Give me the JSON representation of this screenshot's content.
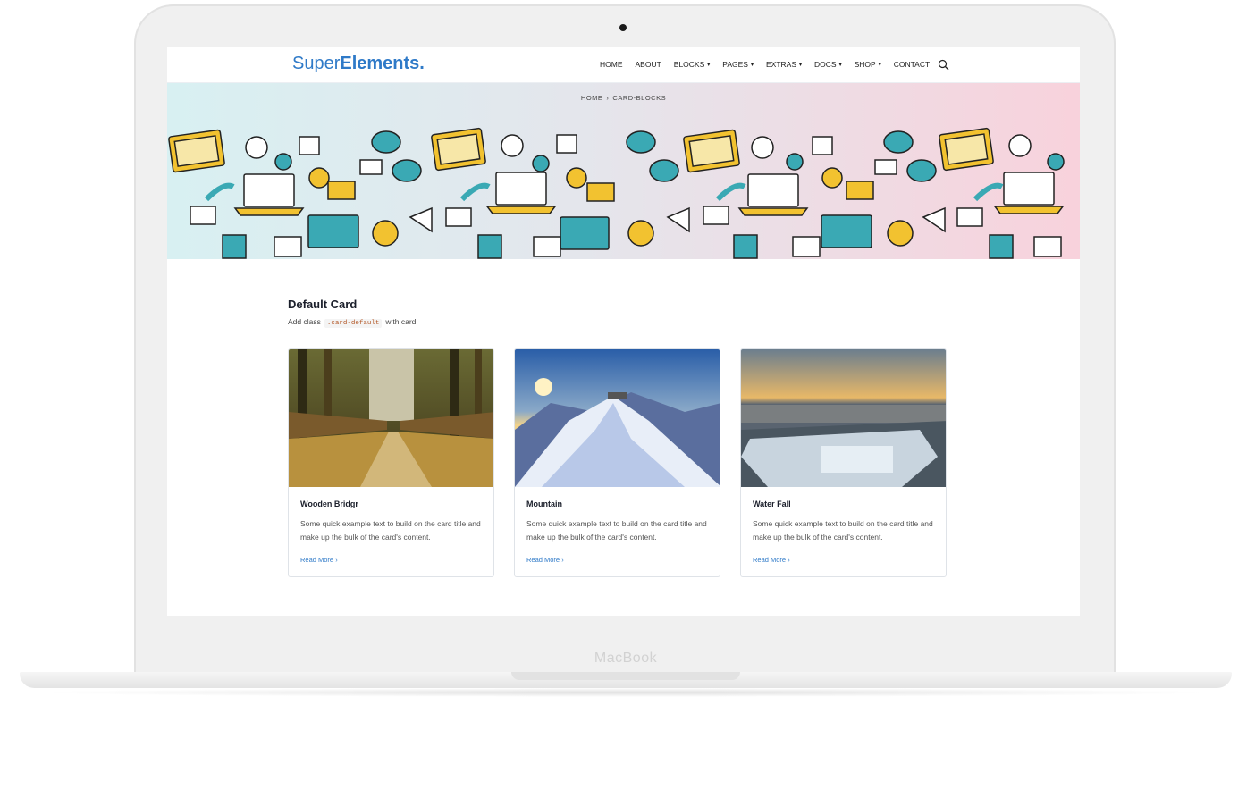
{
  "device": {
    "label": "MacBook"
  },
  "nav": {
    "logo_light": "Super",
    "logo_bold": "Elements.",
    "items": [
      {
        "label": "HOME",
        "caret": false
      },
      {
        "label": "ABOUT",
        "caret": false
      },
      {
        "label": "BLOCKS",
        "caret": true
      },
      {
        "label": "PAGES",
        "caret": true
      },
      {
        "label": "EXTRAS",
        "caret": true
      },
      {
        "label": "DOCS",
        "caret": true
      },
      {
        "label": "SHOP",
        "caret": true
      },
      {
        "label": "CONTACT",
        "caret": false
      }
    ],
    "caret_glyph": "▾",
    "search_icon": "search-icon"
  },
  "breadcrumb": {
    "home": "HOME",
    "separator": "›",
    "current": "CARD-BLOCKS"
  },
  "section": {
    "title": "Default Card",
    "sub_prefix": "Add class",
    "sub_code": ".card-default",
    "sub_suffix": "with card"
  },
  "cards": [
    {
      "title": "Wooden Bridgr",
      "text": "Some quick example text to build on the card title and make up the bulk of the card's content.",
      "link": "Read More",
      "link_icon": "›"
    },
    {
      "title": "Mountain",
      "text": "Some quick example text to build on the card title and make up the bulk of the card's content.",
      "link": "Read More",
      "link_icon": "›"
    },
    {
      "title": "Water Fall",
      "text": "Some quick example text to build on the card title and make up the bulk of the card's content.",
      "link": "Read More",
      "link_icon": "›"
    }
  ],
  "colors": {
    "brand": "#2f7ac8",
    "teal": "#3aa9b4",
    "yellow": "#f2c230",
    "hero_left": "#d8f0f2",
    "hero_right": "#f8d2dc"
  }
}
